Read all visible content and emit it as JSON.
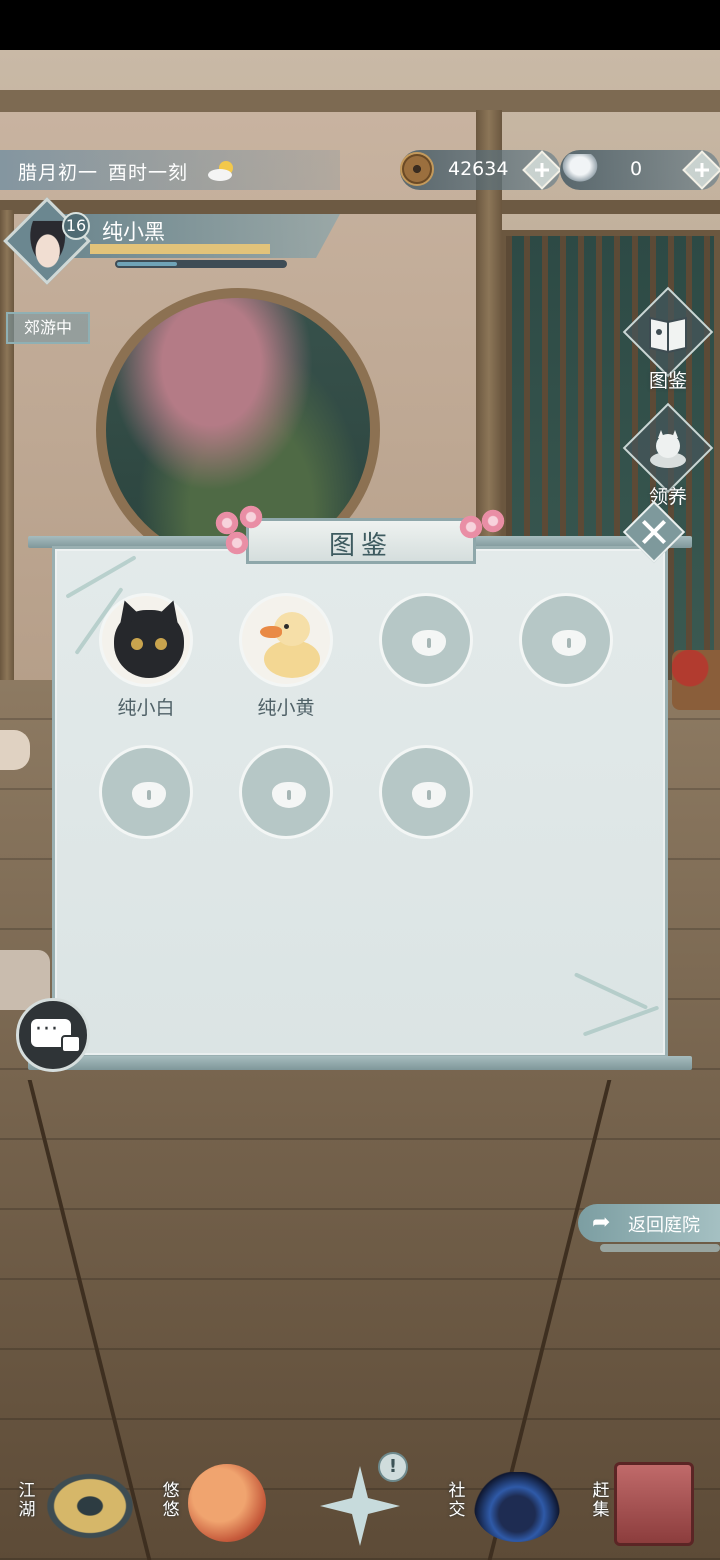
{
  "hud": {
    "date": "腊月初一",
    "time": "酉时一刻",
    "weather_icon": "partly-cloudy-icon",
    "coins": "42634",
    "silver": "0"
  },
  "player": {
    "name": "纯小黑",
    "level": "16",
    "status": "郊游中",
    "exp_progress": 0.9,
    "stamina_progress": 0.36
  },
  "side_buttons": {
    "album": "图鉴",
    "adopt": "领养"
  },
  "panel": {
    "title": "图鉴",
    "pets": [
      {
        "name": "纯小白",
        "unlocked": true,
        "icon": "black-cat-icon"
      },
      {
        "name": "纯小黄",
        "unlocked": true,
        "icon": "yellow-duck-icon"
      },
      {
        "name": "",
        "unlocked": false,
        "icon": "lock-icon"
      },
      {
        "name": "",
        "unlocked": false,
        "icon": "lock-icon"
      },
      {
        "name": "",
        "unlocked": false,
        "icon": "lock-icon"
      },
      {
        "name": "",
        "unlocked": false,
        "icon": "lock-icon"
      },
      {
        "name": "",
        "unlocked": false,
        "icon": "lock-icon"
      }
    ]
  },
  "return_button": "返回庭院",
  "nav": {
    "jianghu": "江湖",
    "youyou": "悠悠",
    "notice": "!",
    "social": "社交",
    "market": "赶集"
  },
  "colors": {
    "panel_bg": "#dfe7e7",
    "accent": "#7e999c",
    "title_text": "#3e5b60"
  }
}
